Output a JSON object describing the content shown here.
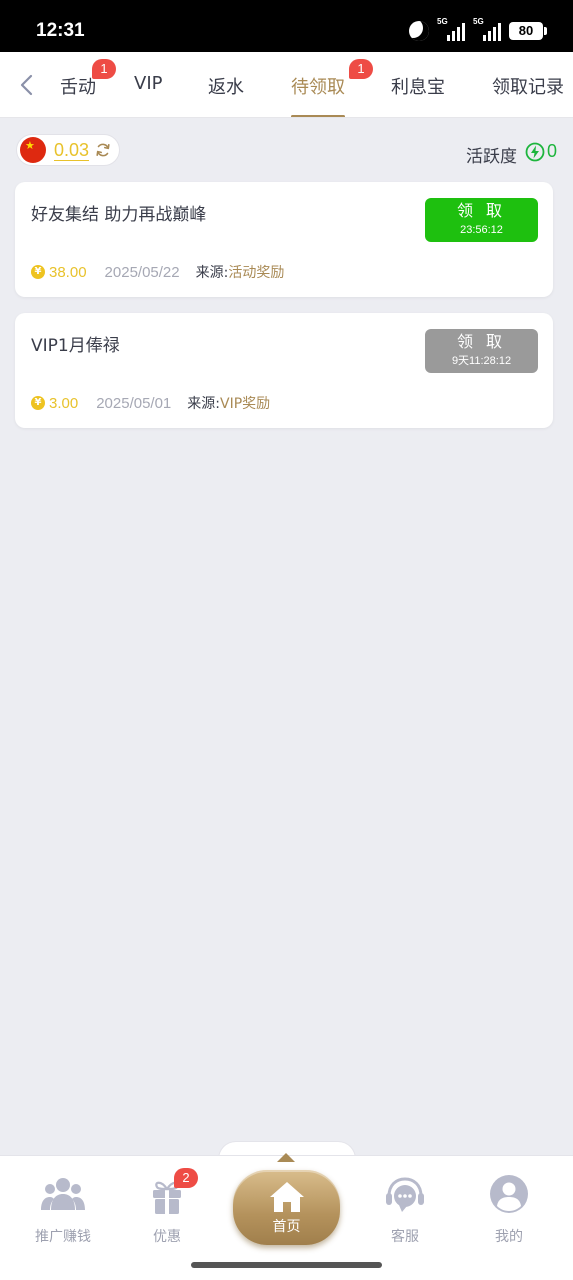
{
  "status_bar": {
    "time": "12:31",
    "sim1_label": "5G",
    "sim2_label": "5G",
    "battery": "80"
  },
  "tabs": [
    {
      "label": "舌动",
      "badge": "1",
      "active": false
    },
    {
      "label": "VIP",
      "badge": "",
      "active": false
    },
    {
      "label": "返水",
      "badge": "",
      "active": false
    },
    {
      "label": "待领取",
      "badge": "1",
      "active": true
    },
    {
      "label": "利息宝",
      "badge": "",
      "active": false
    },
    {
      "label": "领取记录",
      "badge": "",
      "active": false
    }
  ],
  "summary": {
    "balance": "0.03",
    "activity_label": "活跃度",
    "activity_value": "0"
  },
  "rewards": [
    {
      "title": "好友集结 助力再战巅峰",
      "claim_label": "领 取",
      "timer": "23:56:12",
      "claim_state": "available",
      "amount": "38.00",
      "date": "2025/05/22",
      "source_label": "来源:",
      "source_value": "活动奖励"
    },
    {
      "title": "VIP1月俸禄",
      "claim_label": "领 取",
      "timer": "9天11:28:12",
      "claim_state": "locked",
      "amount": "3.00",
      "date": "2025/05/01",
      "source_label": "来源:",
      "source_value": "VIP奖励"
    }
  ],
  "colors": {
    "accent_gold": "#a98a55",
    "claim_green": "#1ec00f",
    "claim_gray": "#9a9a9a",
    "amount_yellow": "#e8c22c",
    "activity_green": "#1db53d",
    "badge_red": "#ee4c45"
  },
  "bottom_nav": {
    "promote": {
      "label": "推广赚钱",
      "icon": "people-icon"
    },
    "offers": {
      "label": "优惠",
      "icon": "gift-icon",
      "badge": "2"
    },
    "home": {
      "label": "首页",
      "icon": "home-icon"
    },
    "support": {
      "label": "客服",
      "icon": "headset-icon"
    },
    "mine": {
      "label": "我的",
      "icon": "user-icon"
    }
  }
}
